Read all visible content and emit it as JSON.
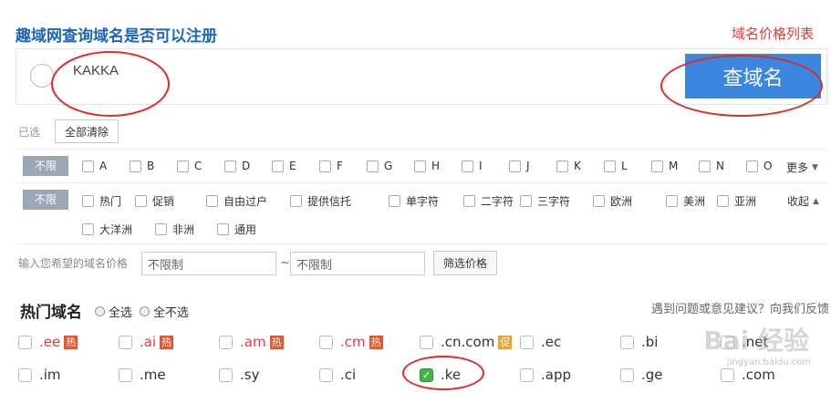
{
  "header": {
    "title": "趣域网查询域名是否可以注册",
    "price_list_link": "域名价格列表"
  },
  "search": {
    "value": "KAKKA",
    "button_label": "查域名"
  },
  "selected": {
    "label": "已选",
    "clear_label": "全部清除"
  },
  "letters": {
    "tag": "不限",
    "items": [
      "A",
      "B",
      "C",
      "D",
      "E",
      "F",
      "G",
      "H",
      "I",
      "J",
      "K",
      "L",
      "M",
      "N",
      "O"
    ],
    "more_label": "更多"
  },
  "categories": {
    "tag": "不限",
    "items": [
      "热门",
      "促销",
      "自由过户",
      "提供信托",
      "单字符",
      "二字符",
      "三字符",
      "欧洲",
      "美洲",
      "亚洲",
      "大洋洲",
      "非洲",
      "通用"
    ],
    "collapse_label": "收起"
  },
  "price": {
    "label": "输入您希望的域名价格",
    "min_value": "不限制",
    "max_value": "不限制",
    "tilde": "~",
    "filter_label": "筛选价格"
  },
  "hot_domains": {
    "title": "热门域名",
    "select_all": "全选",
    "select_none": "全不选",
    "feedback": "遇到问题或意见建议？向我们反馈",
    "row1": [
      {
        "name": ".ee",
        "badge": "热",
        "badge_color": "#e6562e",
        "hot": true
      },
      {
        "name": ".ai",
        "badge": "热",
        "badge_color": "#e6562e",
        "hot": true
      },
      {
        "name": ".am",
        "badge": "热",
        "badge_color": "#e6562e",
        "hot": true
      },
      {
        "name": ".cm",
        "badge": "热",
        "badge_color": "#e6562e",
        "hot": true
      },
      {
        "name": ".cn.com",
        "badge": "促",
        "badge_color": "#f0a030",
        "hot": false
      },
      {
        "name": ".ec",
        "badge": "",
        "hot": false
      },
      {
        "name": ".bi",
        "badge": "",
        "hot": false
      },
      {
        "name": ".net",
        "badge": "",
        "hot": false
      }
    ],
    "row2": [
      {
        "name": ".im",
        "checked": false
      },
      {
        "name": ".me",
        "checked": false
      },
      {
        "name": ".sy",
        "checked": false
      },
      {
        "name": ".ci",
        "checked": false
      },
      {
        "name": ".ke",
        "checked": true
      },
      {
        "name": ".app",
        "checked": false
      },
      {
        "name": ".ge",
        "checked": false
      },
      {
        "name": ".com",
        "checked": false
      }
    ]
  },
  "watermark": {
    "text": "Bai 经验",
    "sub": "jingyan.baidu.com"
  },
  "colors": {
    "accent": "#3b87e0",
    "title_blue": "#1b66b8",
    "hot_red": "#e4393c",
    "tag_gray": "#9aa7b5",
    "annotation_red": "#e02a2a"
  }
}
